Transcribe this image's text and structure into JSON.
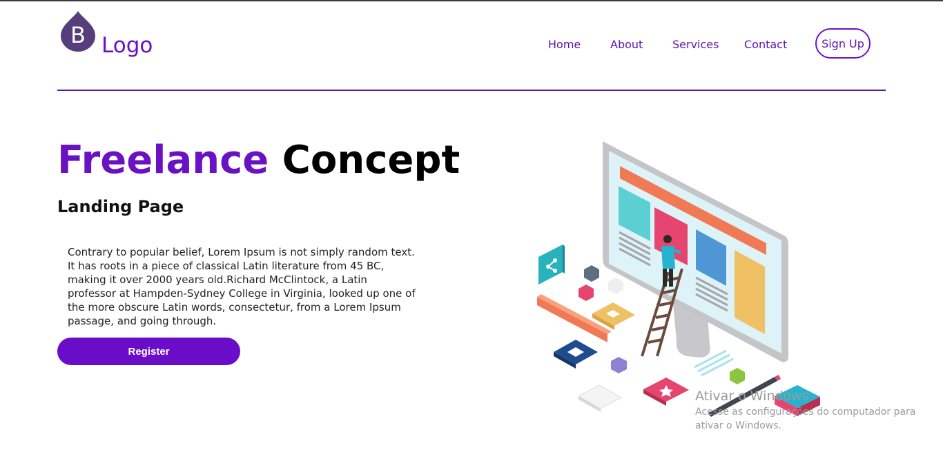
{
  "brand": {
    "logo_letter": "B",
    "logo_text": "Logo",
    "accent": "#6a11c4",
    "logo_color": "#563d7c"
  },
  "nav": {
    "home": "Home",
    "about": "About",
    "services": "Services",
    "contact": "Contact",
    "signup": "Sign Up"
  },
  "hero": {
    "title_part1": "Freelance",
    "title_part2": "Concept",
    "subtitle": "Landing Page",
    "paragraph": "Contrary to popular belief, Lorem Ipsum is not simply random text. It has roots in a piece of classical Latin literature from 45 BC, making it over 2000 years old.Richard McClintock, a Latin professor at Hampden-Sydney College in Virginia, looked up one of the more obscure Latin words, consectetur, from a Lorem Ipsum passage, and going through.",
    "register_label": "Register",
    "illustration": "isometric-freelance-monitor-illustration"
  },
  "watermark": {
    "title": "Ativar o Windows",
    "subtitle": "Acesse as configurações do computador para ativar o Windows."
  }
}
